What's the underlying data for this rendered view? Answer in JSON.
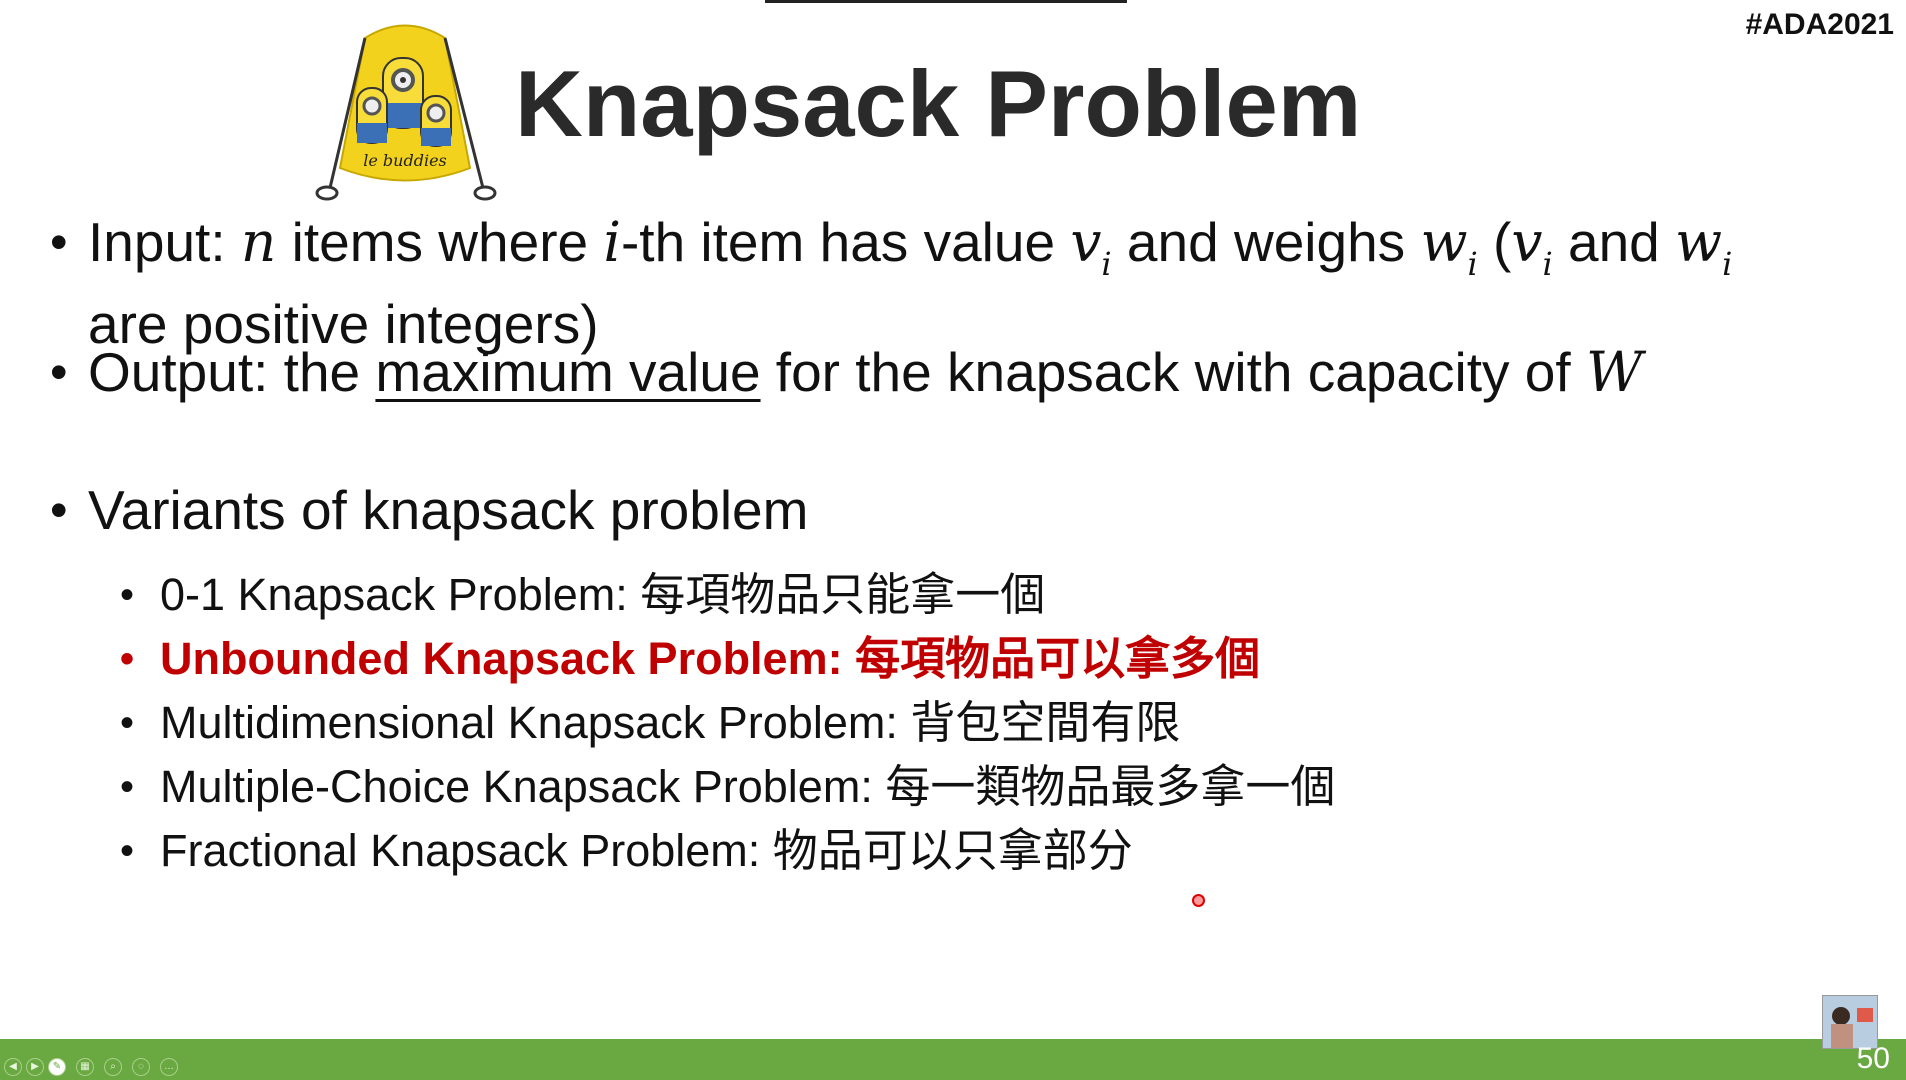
{
  "hashtag": "#ADA2021",
  "title": "Knapsack Problem",
  "bag_logo_text": "le buddies",
  "bullets": {
    "input_prefix": "Input: ",
    "input_n": "n",
    "input_mid1": " items where ",
    "input_i": "i",
    "input_mid2": "-th item has value ",
    "input_v": "v",
    "input_sub_i": "i",
    "input_mid3": " and weighs ",
    "input_w": "w",
    "input_paren_open": " (",
    "input_and": " and ",
    "input_line2": "are positive integers)",
    "output_prefix": "Output: the ",
    "output_underlined": "maximum value",
    "output_suffix": " for the knapsack with capacity of ",
    "output_W": "W",
    "variants": "Variants of knapsack problem"
  },
  "variants": [
    {
      "text": "0-1 Knapsack Problem: 每項物品只能拿一個",
      "highlight": false
    },
    {
      "text": "Unbounded Knapsack Problem: 每項物品可以拿多個",
      "highlight": true
    },
    {
      "text": "Multidimensional Knapsack Problem: 背包空間有限",
      "highlight": false
    },
    {
      "text": "Multiple-Choice Knapsack Problem: 每一類物品最多拿一個",
      "highlight": false
    },
    {
      "text": "Fractional Knapsack Problem: 物品可以只拿部分",
      "highlight": false
    }
  ],
  "slide_number": "50",
  "colors": {
    "accent_red": "#c00000",
    "bar_green": "#6aa842"
  }
}
